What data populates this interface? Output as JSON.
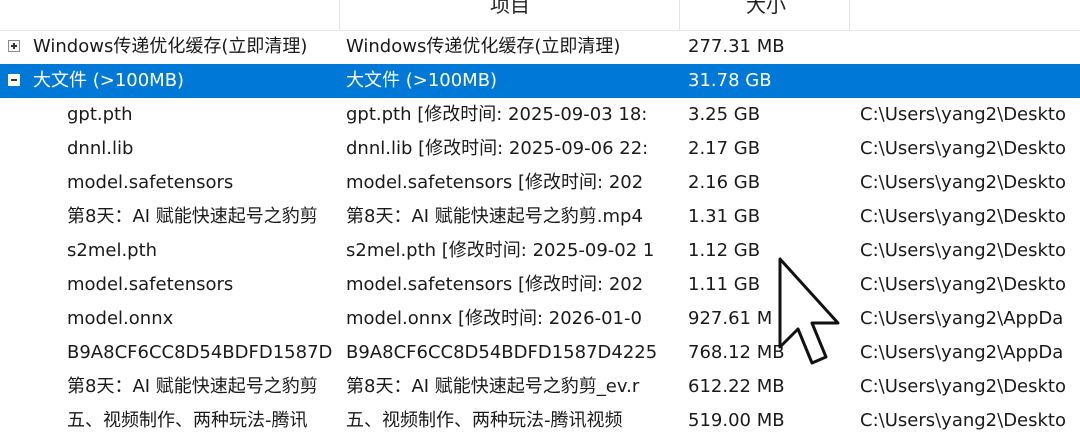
{
  "columns": {
    "item": "项目",
    "size": "大小"
  },
  "rows": [
    {
      "name": "Windows传递优化缓存(立即清理)",
      "item": "Windows传递优化缓存(立即清理)",
      "size": "277.31 MB",
      "path": "",
      "expander": "plus"
    },
    {
      "name": "大文件 (>100MB)",
      "item": "大文件 (>100MB)",
      "size": "31.78 GB",
      "path": "",
      "expander": "minus",
      "selected": true
    },
    {
      "name": "gpt.pth",
      "item": "gpt.pth [修改时间: 2025-09-03 18:",
      "size": "3.25 GB",
      "path": "C:\\Users\\yang2\\Deskto"
    },
    {
      "name": "dnnl.lib",
      "item": "dnnl.lib [修改时间: 2025-09-06 22:",
      "size": "2.17 GB",
      "path": "C:\\Users\\yang2\\Deskto"
    },
    {
      "name": "model.safetensors",
      "item": "model.safetensors [修改时间: 202",
      "size": "2.16 GB",
      "path": "C:\\Users\\yang2\\Deskto"
    },
    {
      "name": "第8天：AI 赋能快速起号之豹剪",
      "item": "第8天：AI 赋能快速起号之豹剪.mp4",
      "size": "1.31 GB",
      "path": "C:\\Users\\yang2\\Deskto"
    },
    {
      "name": "s2mel.pth",
      "item": "s2mel.pth [修改时间: 2025-09-02 1",
      "size": "1.12 GB",
      "path": "C:\\Users\\yang2\\Deskto"
    },
    {
      "name": "model.safetensors",
      "item": "model.safetensors [修改时间: 202",
      "size": "1.11 GB",
      "path": "C:\\Users\\yang2\\Deskto"
    },
    {
      "name": "model.onnx",
      "item": "model.onnx [修改时间: 2026-01-0",
      "size": "927.61 M",
      "path": "C:\\Users\\yang2\\AppDa"
    },
    {
      "name": "B9A8CF6CC8D54BDFD1587D",
      "item": "B9A8CF6CC8D54BDFD1587D4225",
      "size": "768.12 MB",
      "path": "C:\\Users\\yang2\\AppDa"
    },
    {
      "name": "第8天：AI 赋能快速起号之豹剪",
      "item": "第8天：AI 赋能快速起号之豹剪_ev.r",
      "size": "612.22 MB",
      "path": "C:\\Users\\yang2\\Deskto"
    },
    {
      "name": "五、视频制作、两种玩法-腾讯",
      "item": "五、视频制作、两种玩法-腾讯视频",
      "size": "519.00 MB",
      "path": "C:\\Users\\yang2\\Deskto"
    }
  ],
  "icons": {
    "expander_collapsed": "plus-box-icon",
    "expander_expanded": "minus-box-icon",
    "cursor": "mouse-pointer-icon"
  },
  "colors": {
    "selection": "#0078d7",
    "text": "#1a1a1a",
    "selected_text": "#ffffff"
  }
}
